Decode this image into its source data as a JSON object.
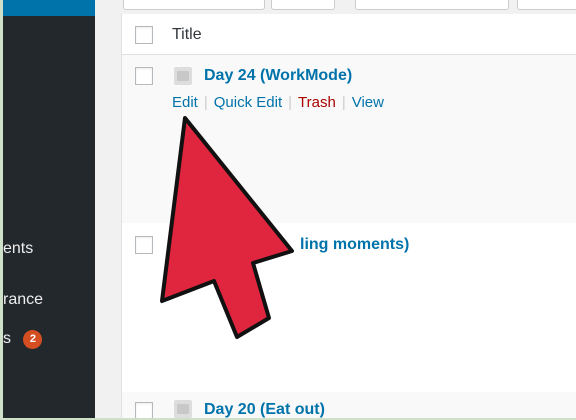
{
  "sidebar": {
    "items": [
      {
        "label": "ents"
      },
      {
        "label": "rance"
      },
      {
        "label": "s",
        "badge": "2"
      }
    ]
  },
  "table": {
    "header": {
      "title": "Title"
    },
    "rows": [
      {
        "title": "Day 24 (WorkMode)",
        "actions": {
          "edit": "Edit",
          "quick_edit": "Quick Edit",
          "trash": "Trash",
          "view": "View"
        }
      },
      {
        "title": "ling moments)"
      },
      {
        "title": "Day 20 (Eat out)"
      }
    ]
  },
  "colors": {
    "link": "#0073aa",
    "trash": "#aa0000",
    "arrow": "#e0263e",
    "sidebar": "#23282d",
    "badge": "#d54e21"
  }
}
